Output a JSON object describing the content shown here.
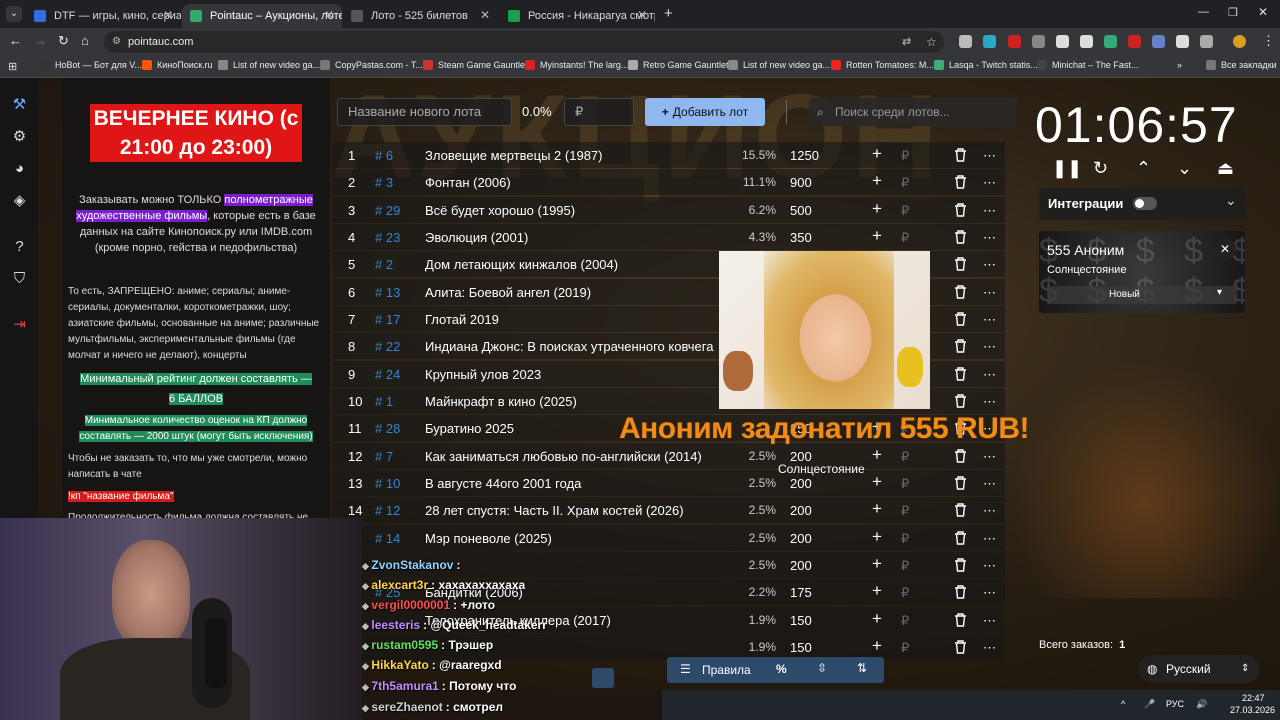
{
  "browser": {
    "tabs": [
      {
        "title": "DTF — игры, кино, сериалы, р",
        "favicon_color": "#2d6fe0",
        "active": false
      },
      {
        "title": "Pointauc – Аукционы, лотереи",
        "favicon_color": "#35a76b",
        "active": true
      },
      {
        "title": "Лото - 525 билетов",
        "favicon_color": "#555555",
        "active": false
      },
      {
        "title": "Россия - Никарагуа смотреть",
        "favicon_color": "#1aa04a",
        "active": false
      }
    ],
    "new_tab": "+",
    "address": "pointauc.com",
    "bookmarks": [
      {
        "label": "HoBot — Бот для V...",
        "color": "#333"
      },
      {
        "label": "КиноПоиск.ru",
        "color": "#ff5500"
      },
      {
        "label": "List of new video ga...",
        "color": "#888"
      },
      {
        "label": "CopyPastas.com - T...",
        "color": "#777"
      },
      {
        "label": "Steam Game Gauntlet",
        "color": "#c33"
      },
      {
        "label": "Myinstants! The larg...",
        "color": "#d22"
      },
      {
        "label": "Retro Game Gauntlet",
        "color": "#aaa"
      },
      {
        "label": "List of new video ga...",
        "color": "#888"
      },
      {
        "label": "Rotten Tomatoes: M...",
        "color": "#e22"
      },
      {
        "label": "Lasqa - Twitch statis...",
        "color": "#4a7"
      },
      {
        "label": "Minichat – The Fast...",
        "color": "#444"
      }
    ],
    "bookmarks_more": "»",
    "all_bookmarks": "Все закладки"
  },
  "rules": {
    "title": "ВЕЧЕРНЕЕ КИНО (с 21:00 до 23:00)",
    "p1_before": "Заказывать можно ТОЛЬКО ",
    "p1_highlight": "полнометражные художественные фильмы",
    "p1_after": ", которые есть в базе данных на сайте Кинопоиск.ру или IMDB.com (кроме порно, гейства и педофильства)",
    "p2": "То есть, ЗАПРЕЩЕНО: аниме; сериалы; аниме-сериалы, документалки, короткометражки, шоу; азиатские фильмы, основанные на аниме; различные мультфильмы, экспериментальные фильмы (где молчат и ничего не делают), концерты",
    "min_rating": "Минимальный рейтинг должен составлять —",
    "min_rating_value": "6 БАЛЛОВ",
    "min_votes": "Минимальное количество оценок на КП должно составлять — 2000 штук (могут быть исключения)",
    "p3": "Чтобы не заказать то, что мы уже смотрели, можно написать в чате",
    "command": "!кп \"название фильма\"",
    "p4": "Продолжительность фильма должна составлять не"
  },
  "controls": {
    "lot_placeholder": "Название нового лота",
    "percent": "0.0%",
    "currency": "₽",
    "add_button": "Добавить лот",
    "search_placeholder": "Поиск среди лотов..."
  },
  "lots": [
    {
      "n": "1",
      "id": "# 6",
      "name": "Зловещие мертвецы 2 (1987)",
      "pct": "15.5%",
      "amount": "1250"
    },
    {
      "n": "2",
      "id": "# 3",
      "name": "Фонтан (2006)",
      "pct": "11.1%",
      "amount": "900"
    },
    {
      "n": "3",
      "id": "# 29",
      "name": "Всё будет хорошо (1995)",
      "pct": "6.2%",
      "amount": "500"
    },
    {
      "n": "4",
      "id": "# 23",
      "name": "Эволюция (2001)",
      "pct": "4.3%",
      "amount": "350"
    },
    {
      "n": "5",
      "id": "# 2",
      "name": "Дом летающих кинжалов (2004)",
      "pct": "",
      "amount": ""
    },
    {
      "n": "6",
      "id": "# 13",
      "name": "Алита: Боевой ангел (2019)",
      "pct": "",
      "amount": ""
    },
    {
      "n": "7",
      "id": "# 17",
      "name": "Глотай 2019",
      "pct": "",
      "amount": ""
    },
    {
      "n": "8",
      "id": "# 22",
      "name": "Индиана Джонс: В поисках утраченного ковчега",
      "pct": "",
      "amount": ""
    },
    {
      "n": "9",
      "id": "# 24",
      "name": "Крупный улов 2023",
      "pct": "",
      "amount": ""
    },
    {
      "n": "10",
      "id": "# 1",
      "name": "Майнкрафт в кино (2025)",
      "pct": "",
      "amount": ""
    },
    {
      "n": "11",
      "id": "# 28",
      "name": "Буратино 2025",
      "pct": "",
      "amount": "250"
    },
    {
      "n": "12",
      "id": "# 7",
      "name": "Как заниматься любовью по-английски (2014)",
      "pct": "2.5%",
      "amount": "200"
    },
    {
      "n": "13",
      "id": "# 10",
      "name": "В августе 44ого 2001 года",
      "pct": "2.5%",
      "amount": "200"
    },
    {
      "n": "14",
      "id": "# 12",
      "name": "28 лет спустя: Часть II. Храм костей (2026)",
      "pct": "2.5%",
      "amount": "200"
    },
    {
      "n": "",
      "id": "# 14",
      "name": "Мэр поневоле (2025)",
      "pct": "2.5%",
      "amount": "200"
    },
    {
      "n": "",
      "id": "",
      "name": "",
      "pct": "2.5%",
      "amount": "200"
    },
    {
      "n": "",
      "id": "# 25",
      "name": "Бандитки (2006)",
      "pct": "2.2%",
      "amount": "175"
    },
    {
      "n": "",
      "id": "",
      "name": "Телохранитель киллера (2017)",
      "pct": "1.9%",
      "amount": "150"
    },
    {
      "n": "",
      "id": "",
      "name": "",
      "pct": "1.9%",
      "amount": "150"
    }
  ],
  "row_icons": {
    "plus": "+",
    "rub": "₽",
    "trash": "trash-icon",
    "more": "⋯"
  },
  "donation": {
    "text": "Аноним задонатил 555 RUB!",
    "message": "Солнцестояние"
  },
  "timer": {
    "value": "01:06:57"
  },
  "integrations": {
    "label": "Интеграции",
    "chevron": "⌄"
  },
  "donation_card": {
    "title": "555 Аноним",
    "message": "Солнцестояние",
    "status": "Новый"
  },
  "orders": {
    "label": "Всего заказов:",
    "count": "1"
  },
  "language": {
    "label": "Русский"
  },
  "bottom_toolbar": {
    "rules": "Правила",
    "percent": "%"
  },
  "chat": [
    {
      "user": "ZvonStakanov",
      "text": ":",
      "color": "#8fd3ff"
    },
    {
      "user": "alexcart3r",
      "text": ": хахахаххахаха",
      "color": "#ffd54a"
    },
    {
      "user": "vergil0000001",
      "text": ": +лото",
      "color": "#ff4d4d"
    },
    {
      "user": "leesteris",
      "text": ": @Queek_headtakerr",
      "color": "#c08cff"
    },
    {
      "user": "rustam0595",
      "text": ": Трэшер",
      "color": "#60e060"
    },
    {
      "user": "HikkaYato",
      "text": ": @raaregxd",
      "color": "#ffd54a"
    },
    {
      "user": "7th5amura1",
      "text": ": Потому что",
      "color": "#c08cff"
    },
    {
      "user": "sereZhaenot",
      "text": ": смотрел",
      "color": "#cfcfcf"
    }
  ],
  "taskbar": {
    "lang": "РУС",
    "time": "22:47",
    "date": "27.03.2026"
  }
}
